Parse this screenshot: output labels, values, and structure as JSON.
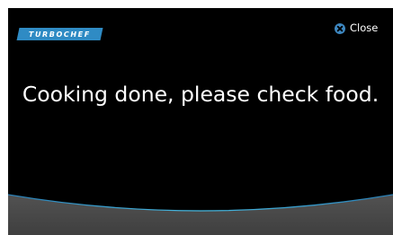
{
  "logo": {
    "text": "TURBOCHEF"
  },
  "close": {
    "label": "Close"
  },
  "message": {
    "text": "Cooking done, please check food."
  },
  "colors": {
    "background": "#000000",
    "brand_blue": "#2f8bc4",
    "close_icon": "#3d87c0",
    "footer_gray": "#4d4d4d",
    "divider_line": "#3aa9d6"
  },
  "icons": {
    "close": "close-icon",
    "logo": "turbochef-logo"
  }
}
